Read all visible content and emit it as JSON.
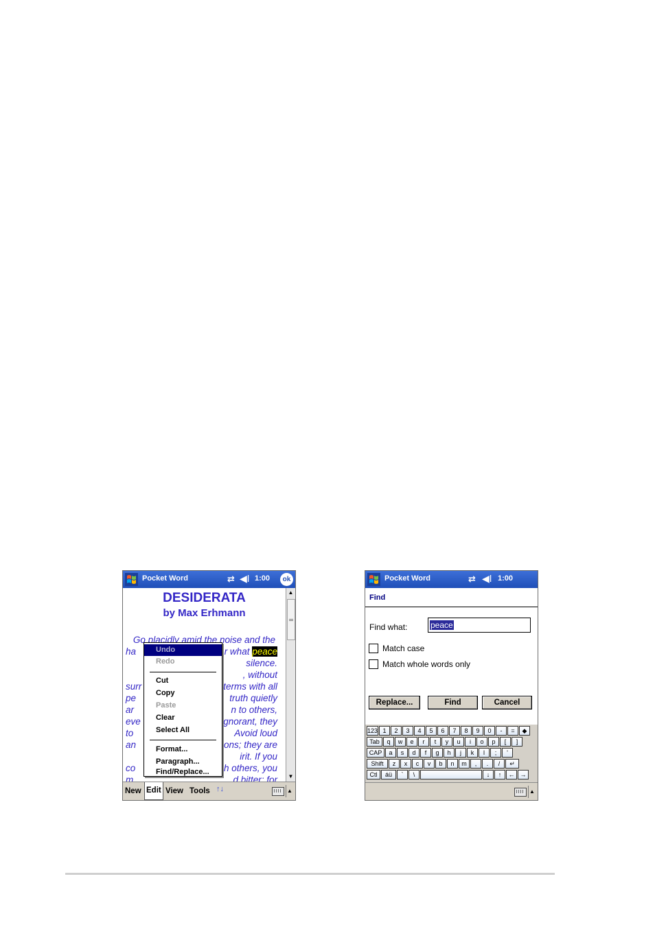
{
  "screen1": {
    "app_title": "Pocket Word",
    "clock": "1:00",
    "ok_label": "ok",
    "document": {
      "title": "DESIDERATA",
      "subtitle": "by Max Erhmann",
      "lines": [
        {
          "pre": "Go placidly amid the noise and the",
          "hl": "",
          "post": ""
        },
        {
          "pre": "ha",
          "mid": "r what ",
          "hl": "peace",
          "post": ""
        },
        {
          "pre": "",
          "mid": "silence.",
          "hl": "",
          "post": ""
        },
        {
          "pre": "",
          "mid": ", without",
          "hl": "",
          "post": ""
        },
        {
          "pre": "surr",
          "mid": "f terms with all",
          "hl": "",
          "post": ""
        },
        {
          "pre": "pe",
          "mid": "truth quietly",
          "hl": "",
          "post": ""
        },
        {
          "pre": "ar",
          "mid": "n to others,",
          "hl": "",
          "post": ""
        },
        {
          "pre": "eve",
          "mid": "gnorant, they",
          "hl": "",
          "post": ""
        },
        {
          "pre": "to",
          "mid": "Avoid loud",
          "hl": "",
          "post": ""
        },
        {
          "pre": "an",
          "mid": "ons; they are",
          "hl": "",
          "post": ""
        },
        {
          "pre": "",
          "mid": "irit. If you",
          "hl": "",
          "post": ""
        },
        {
          "pre": "co",
          "mid": "h others, you",
          "hl": "",
          "post": ""
        },
        {
          "pre": "m",
          "mid": "d bitter; for",
          "hl": "",
          "post": ""
        }
      ]
    },
    "edit_menu": {
      "items": [
        {
          "label": "Undo",
          "state": "selected"
        },
        {
          "label": "Redo",
          "state": "disabled"
        },
        {
          "label": "Cut",
          "state": "enabled"
        },
        {
          "label": "Copy",
          "state": "enabled"
        },
        {
          "label": "Paste",
          "state": "disabled"
        },
        {
          "label": "Clear",
          "state": "enabled"
        },
        {
          "label": "Select All",
          "state": "enabled"
        },
        {
          "label": "Format...",
          "state": "enabled"
        },
        {
          "label": "Paragraph...",
          "state": "enabled"
        },
        {
          "label": "Find/Replace...",
          "state": "enabled"
        }
      ]
    },
    "command_bar": {
      "new": "New",
      "edit": "Edit",
      "view": "View",
      "tools": "Tools",
      "extra": "↑↓"
    }
  },
  "screen2": {
    "app_title": "Pocket Word",
    "clock": "1:00",
    "dialog_title": "Find",
    "find_label": "Find what:",
    "find_value": "peace",
    "match_case": "Match case",
    "match_whole": "Match whole words only",
    "buttons": {
      "replace": "Replace...",
      "find": "Find",
      "cancel": "Cancel"
    },
    "keyboard": {
      "row1": [
        "123",
        "1",
        "2",
        "3",
        "4",
        "5",
        "6",
        "7",
        "8",
        "9",
        "0",
        "-",
        "=",
        "◆"
      ],
      "row2": [
        "Tab",
        "q",
        "w",
        "e",
        "r",
        "t",
        "y",
        "u",
        "i",
        "o",
        "p",
        "[",
        "]"
      ],
      "row3": [
        "CAP",
        "a",
        "s",
        "d",
        "f",
        "g",
        "h",
        "j",
        "k",
        "l",
        ";",
        "'"
      ],
      "row4": [
        "Shift",
        "z",
        "x",
        "c",
        "v",
        "b",
        "n",
        "m",
        ",",
        ".",
        "/",
        "↵"
      ],
      "row5": [
        "Ctl",
        "áü",
        "`",
        "\\",
        "",
        "↓",
        "↑",
        "←",
        "→"
      ]
    }
  },
  "colors": {
    "titlebar": "#2450b5",
    "document_text": "#3326c6",
    "highlight": "#ffff00",
    "menu_selected": "#000080",
    "command_bar": "#d8d3c8"
  }
}
